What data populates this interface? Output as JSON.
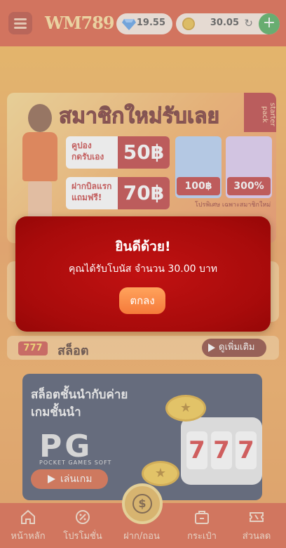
{
  "header": {
    "logo": "WM789",
    "diamond_balance": "19.55",
    "coin_balance": "30.05",
    "add_label": "+"
  },
  "banner": {
    "title": "สมาชิกใหม่รับเลย",
    "badge": "starter pack",
    "coupon_1": {
      "label_line1": "คูปอง",
      "label_line2": "กดรับเอง",
      "amount": "50฿"
    },
    "coupon_2": {
      "label_line1": "ฝากบิลแรก",
      "label_line2": "แถมฟรี!",
      "amount": "70฿"
    },
    "promo_1": "100฿",
    "promo_2": "300%",
    "note": "โปรพิเศษ เฉพาะสมาชิกใหม่"
  },
  "slot_section": {
    "icon_text": "777",
    "title": "สล็อต",
    "more_label": "ดูเพิ่มเติม"
  },
  "provider_card": {
    "title_line1": "สล็อตชั้นนำกับค่าย",
    "title_line2": "เกมชั้นนำ",
    "logo": "PG",
    "logo_sub": "POCKET GAMES SOFT",
    "play_label": "เล่นเกม",
    "reel_symbol": "7"
  },
  "bottom_nav": {
    "items": [
      {
        "label": "หน้าหลัก",
        "icon": "home-icon"
      },
      {
        "label": "โปรโมชั่น",
        "icon": "promotion-icon"
      },
      {
        "label": "ฝาก/ถอน",
        "icon": "deposit-coin-icon"
      },
      {
        "label": "กระเป๋า",
        "icon": "wallet-icon"
      },
      {
        "label": "ส่วนลด",
        "icon": "discount-ticket-icon"
      }
    ]
  },
  "modal": {
    "title": "ยินดีด้วย!",
    "message": "คุณได้รับโบนัส จำนวน 30.00 บาท",
    "ok_label": "ตกลง"
  },
  "colors": {
    "header": "#d8421f",
    "modal": "#b00d0d",
    "ok_button": "#f57a3a"
  }
}
